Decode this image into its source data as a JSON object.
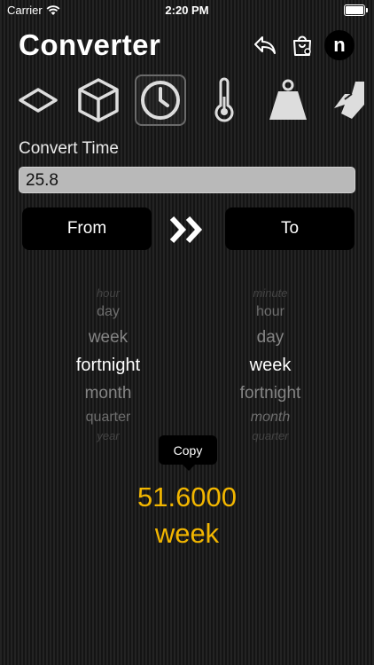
{
  "status_bar": {
    "carrier": "Carrier",
    "time": "2:20 PM"
  },
  "header": {
    "title": "Converter",
    "avatar_letter": "n"
  },
  "header_icons": [
    "undo-arrow-icon",
    "shopping-bag-icon"
  ],
  "categories": [
    {
      "icon": "area-diamond-icon",
      "selected": false
    },
    {
      "icon": "volume-cube-icon",
      "selected": false
    },
    {
      "icon": "clock-icon",
      "selected": true
    },
    {
      "icon": "thermometer-icon",
      "selected": false
    },
    {
      "icon": "weight-icon",
      "selected": false
    },
    {
      "icon": "speed-icon",
      "selected": false
    }
  ],
  "converter": {
    "label": "Convert Time",
    "input_value": "25.8",
    "from_label": "From",
    "to_label": "To"
  },
  "from_picker": {
    "items": [
      "hour",
      "day",
      "week",
      "fortnight",
      "month",
      "quarter",
      "year"
    ],
    "selected": "fortnight"
  },
  "to_picker": {
    "items": [
      "minute",
      "hour",
      "day",
      "week",
      "fortnight",
      "month",
      "quarter"
    ],
    "selected": "week"
  },
  "copy_tooltip": "Copy",
  "result": {
    "value": "51.6000",
    "unit": "week"
  },
  "colors": {
    "accent": "#f2b600",
    "input_bg": "#b9b9b9",
    "button_bg": "#000000"
  }
}
